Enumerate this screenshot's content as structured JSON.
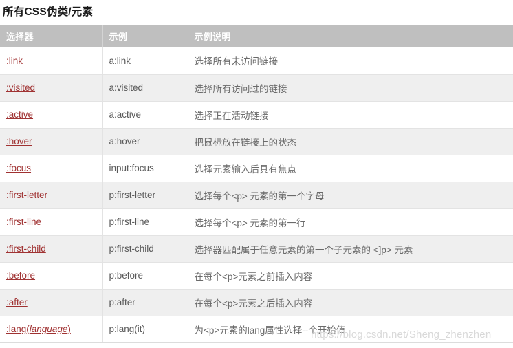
{
  "page": {
    "title": "所有CSS伪类/元素"
  },
  "table": {
    "headers": [
      "选择器",
      "示例",
      "示例说明"
    ],
    "rows": [
      {
        "selector": ":link",
        "selector_italic": "",
        "selector_suffix": "",
        "example": "a:link",
        "description": "选择所有未访问链接"
      },
      {
        "selector": ":visited",
        "selector_italic": "",
        "selector_suffix": "",
        "example": "a:visited",
        "description": "选择所有访问过的链接"
      },
      {
        "selector": ":active",
        "selector_italic": "",
        "selector_suffix": "",
        "example": "a:active",
        "description": "选择正在活动链接"
      },
      {
        "selector": ":hover",
        "selector_italic": "",
        "selector_suffix": "",
        "example": "a:hover",
        "description": "把鼠标放在链接上的状态"
      },
      {
        "selector": ":focus",
        "selector_italic": "",
        "selector_suffix": "",
        "example": "input:focus",
        "description": "选择元素输入后具有焦点"
      },
      {
        "selector": ":first-letter",
        "selector_italic": "",
        "selector_suffix": "",
        "example": "p:first-letter",
        "description": "选择每个<p> 元素的第一个字母"
      },
      {
        "selector": ":first-line",
        "selector_italic": "",
        "selector_suffix": "",
        "example": "p:first-line",
        "description": "选择每个<p> 元素的第一行"
      },
      {
        "selector": ":first-child",
        "selector_italic": "",
        "selector_suffix": "",
        "example": "p:first-child",
        "description": "选择器匹配属于任意元素的第一个子元素的 <]p> 元素"
      },
      {
        "selector": ":before",
        "selector_italic": "",
        "selector_suffix": "",
        "example": "p:before",
        "description": "在每个<p>元素之前插入内容"
      },
      {
        "selector": ":after",
        "selector_italic": "",
        "selector_suffix": "",
        "example": "p:after",
        "description": "在每个<p>元素之后插入内容"
      },
      {
        "selector": ":lang(",
        "selector_italic": "language",
        "selector_suffix": ")",
        "example": "p:lang(it)",
        "description": "为<p>元素的lang属性选择--个开始值"
      }
    ]
  },
  "watermark": {
    "text": "https://blog.csdn.net/Sheng_zhenzhen"
  },
  "colors": {
    "header_bg": "#bfbfbf",
    "header_text": "#ffffff",
    "link": "#a03232",
    "row_alt_bg": "#efefef",
    "row_bg": "#ffffff",
    "body_text": "#5a5a5a",
    "watermark": "#d9d9d9"
  }
}
